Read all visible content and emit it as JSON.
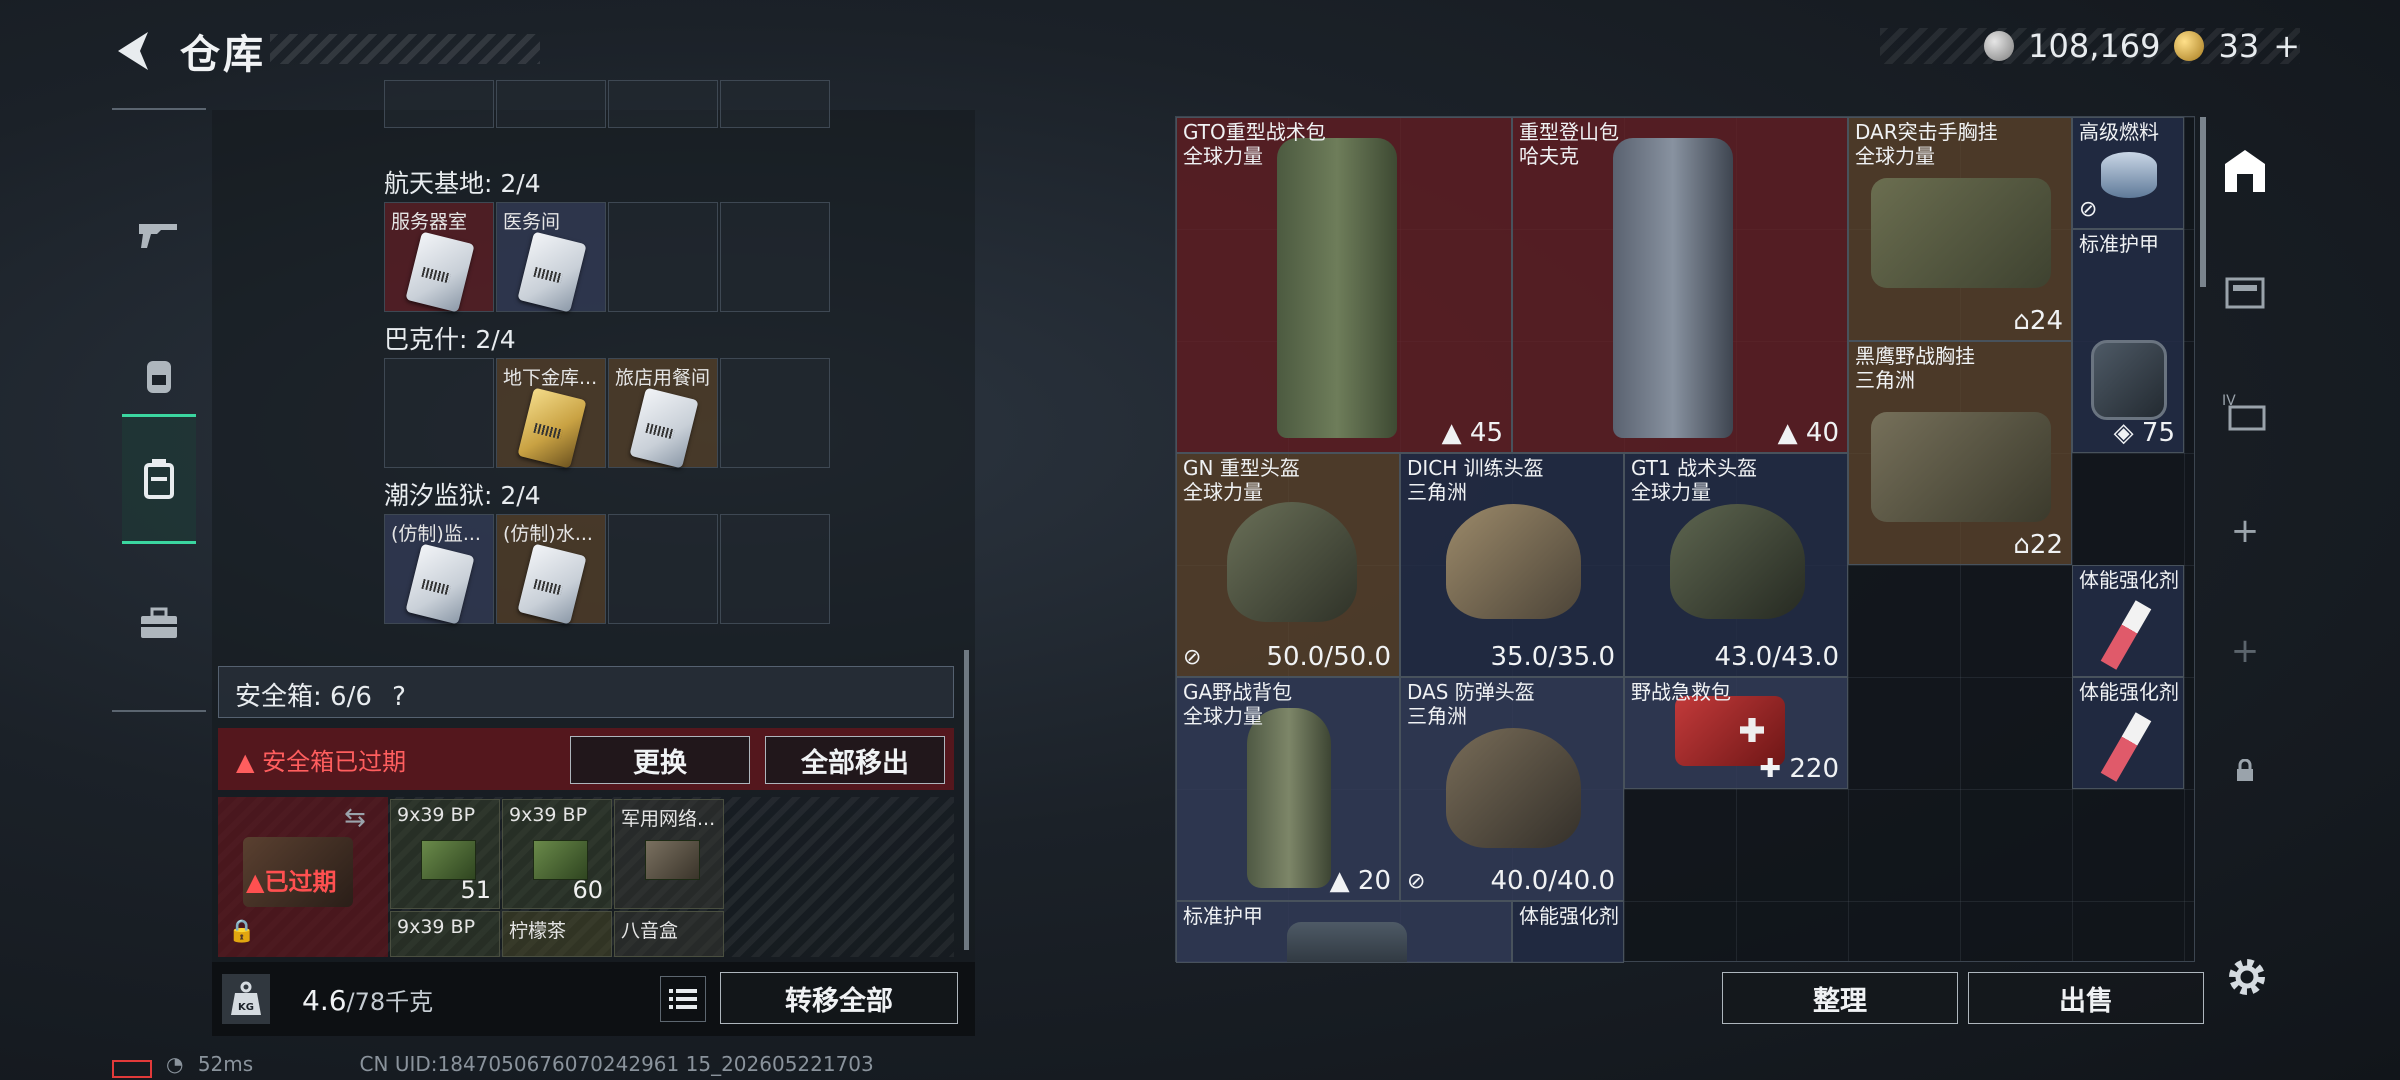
{
  "header": {
    "title": "仓库"
  },
  "currency": {
    "silver": "108,169",
    "gold": "33",
    "gold_plus": "+"
  },
  "colors": {
    "accent": "#3bd6a0",
    "danger": "#ff5050",
    "panel": "#141a20"
  },
  "rail": {
    "items": [
      "gun-icon",
      "backpack-icon",
      "case-icon",
      "toolbox-icon"
    ],
    "active_index": 2
  },
  "keycards": {
    "groups": [
      {
        "title": "航天基地: 2/4",
        "slots": [
          "服务器室",
          "医务间",
          "",
          ""
        ]
      },
      {
        "title": "巴克什: 2/4",
        "slots": [
          "",
          "地下金库...",
          "旅店用餐间",
          ""
        ]
      },
      {
        "title": "潮汐监狱: 2/4",
        "slots": [
          "(仿制)监...",
          "(仿制)水...",
          "",
          ""
        ]
      }
    ]
  },
  "safebox": {
    "label": "安全箱: 6/6",
    "help": "?",
    "expired_text": "安全箱已过期",
    "replace_label": "更换",
    "remove_all_label": "全部移出",
    "expired_badge": "已过期",
    "items": [
      {
        "name": "9x39 BP",
        "count": "51"
      },
      {
        "name": "9x39 BP",
        "count": "60"
      },
      {
        "name": "军用网络...",
        "count": ""
      },
      {
        "name": "9x39 BP",
        "count": ""
      },
      {
        "name": "柠檬茶",
        "count": ""
      },
      {
        "name": "八音盒",
        "count": ""
      }
    ]
  },
  "bottom": {
    "weight": "4.6",
    "weight_unit": "/78千克",
    "kg_label": "KG",
    "transfer_label": "转移全部"
  },
  "status": {
    "ping": "52ms",
    "uid": "CN UID:1847050676070242961 15_202605221703"
  },
  "stash": {
    "items": [
      {
        "name": "GTO重型战术包",
        "sub": "全球力量",
        "value": "45"
      },
      {
        "name": "重型登山包",
        "sub": "哈夫克",
        "value": "40"
      },
      {
        "name": "DAR突击手胸挂",
        "sub": "全球力量",
        "value": "24"
      },
      {
        "name": "高级燃料",
        "sub": "",
        "value": ""
      },
      {
        "name": "标准护甲",
        "sub": "",
        "value": "75"
      },
      {
        "name": "黑鹰野战胸挂",
        "sub": "三角洲",
        "value": "22"
      },
      {
        "name": "GN 重型头盔",
        "sub": "全球力量",
        "value": "50.0/50.0"
      },
      {
        "name": "DICH 训练头盔",
        "sub": "三角洲",
        "value": "35.0/35.0"
      },
      {
        "name": "GT1 战术头盔",
        "sub": "全球力量",
        "value": "43.0/43.0"
      },
      {
        "name": "体能强化剂",
        "sub": "",
        "value": ""
      },
      {
        "name": "GA野战背包",
        "sub": "全球力量",
        "value": "20"
      },
      {
        "name": "DAS 防弹头盔",
        "sub": "三角洲",
        "value": "40.0/40.0"
      },
      {
        "name": "野战急救包",
        "sub": "",
        "value": "220"
      },
      {
        "name": "体能强化剂",
        "sub": "",
        "value": ""
      },
      {
        "name": "标准护甲",
        "sub": "",
        "value": ""
      },
      {
        "name": "体能强化剂",
        "sub": "",
        "value": ""
      }
    ],
    "sort_label": "整理",
    "sell_label": "出售"
  },
  "right_rail": {
    "items": [
      "stash-icon",
      "shelf-icon",
      "iv-icon",
      "add-icon",
      "add-icon",
      "lock-icon"
    ]
  }
}
